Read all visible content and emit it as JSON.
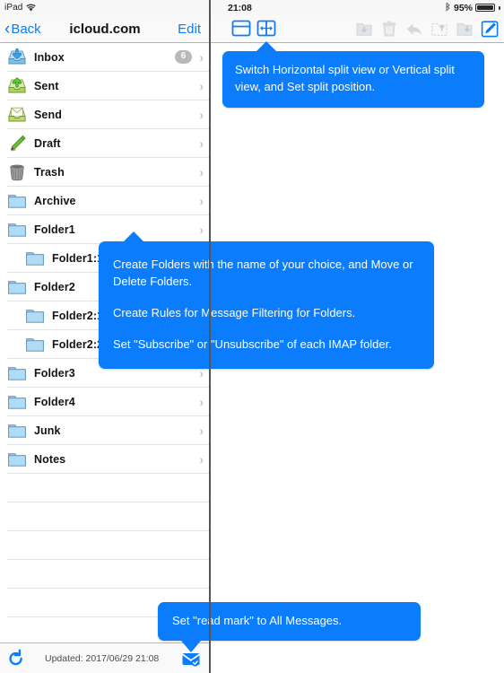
{
  "status_bar": {
    "device": "iPad",
    "wifi_icon": "wifi-icon",
    "time": "21:08",
    "bluetooth_icon": "bluetooth-icon",
    "battery_percent": "95%"
  },
  "nav_bar": {
    "back_label": "Back",
    "title": "icloud.com",
    "edit_label": "Edit"
  },
  "right_toolbar": {
    "split_buttons": [
      {
        "name": "horizontal-split-view-button",
        "icon": "horizontal-split-icon"
      },
      {
        "name": "vertical-split-view-button",
        "icon": "vertical-split-icon"
      }
    ],
    "tools": [
      {
        "name": "archive-button",
        "icon": "archive-folder-down-icon",
        "enabled": false
      },
      {
        "name": "delete-button",
        "icon": "trash-icon",
        "enabled": false
      },
      {
        "name": "reply-button",
        "icon": "reply-arrow-icon",
        "enabled": false
      },
      {
        "name": "move-to-folder-button",
        "icon": "folder-up-icon",
        "enabled": false
      },
      {
        "name": "copy-to-folder-button",
        "icon": "folder-down-icon",
        "enabled": false
      },
      {
        "name": "compose-button",
        "icon": "compose-pencil-icon",
        "enabled": true
      }
    ]
  },
  "mailboxes": [
    {
      "label": "Inbox",
      "icon": "inbox-tray-down-icon",
      "badge": "6",
      "indent": 0,
      "chevron": true
    },
    {
      "label": "Sent",
      "icon": "sent-tray-up-icon",
      "badge": "",
      "indent": 0,
      "chevron": true
    },
    {
      "label": "Send",
      "icon": "outbox-envelope-icon",
      "badge": "",
      "indent": 0,
      "chevron": true
    },
    {
      "label": "Draft",
      "icon": "pencil-icon",
      "badge": "",
      "indent": 0,
      "chevron": true
    },
    {
      "label": "Trash",
      "icon": "trash-can-icon",
      "badge": "",
      "indent": 0,
      "chevron": true
    },
    {
      "label": "Archive",
      "icon": "folder-icon",
      "badge": "",
      "indent": 0,
      "chevron": true
    },
    {
      "label": "Folder1",
      "icon": "folder-icon",
      "badge": "",
      "indent": 0,
      "chevron": true
    },
    {
      "label": "Folder1:1",
      "icon": "folder-icon",
      "badge": "",
      "indent": 1,
      "chevron": true
    },
    {
      "label": "Folder2",
      "icon": "folder-icon",
      "badge": "",
      "indent": 0,
      "chevron": true
    },
    {
      "label": "Folder2:1",
      "icon": "folder-icon",
      "badge": "",
      "indent": 1,
      "chevron": true
    },
    {
      "label": "Folder2:2",
      "icon": "folder-icon",
      "badge": "",
      "indent": 1,
      "chevron": true
    },
    {
      "label": "Folder3",
      "icon": "folder-icon",
      "badge": "",
      "indent": 0,
      "chevron": true
    },
    {
      "label": "Folder4",
      "icon": "folder-icon",
      "badge": "",
      "indent": 0,
      "chevron": true
    },
    {
      "label": "Junk",
      "icon": "folder-icon",
      "badge": "",
      "indent": 0,
      "chevron": true
    },
    {
      "label": "Notes",
      "icon": "folder-icon",
      "badge": "",
      "indent": 0,
      "chevron": true
    }
  ],
  "bottom_bar": {
    "refresh_icon": "refresh-icon",
    "updated_text": "Updated: 2017/06/29 21:08",
    "read_mark_icon": "envelope-check-icon"
  },
  "callouts": {
    "split": {
      "text": "Switch  Horizontal split view or Vertical split view, and Set split position."
    },
    "folders": {
      "line1": "Create Folders with the name of your choice, and Move or Delete Folders.",
      "line2": "Create Rules for Message Filtering for Folders.",
      "line3": "Set \"Subscribe\" or \"Unsubscribe\" of each IMAP folder."
    },
    "read_mark": {
      "text": "Set \"read mark\" to All Messages."
    }
  },
  "colors": {
    "accent": "#0b7cfb",
    "callout_bg": "#0b7cfb",
    "badge_bg": "#b9b9b9",
    "bar_bg": "#f9f9f9"
  }
}
